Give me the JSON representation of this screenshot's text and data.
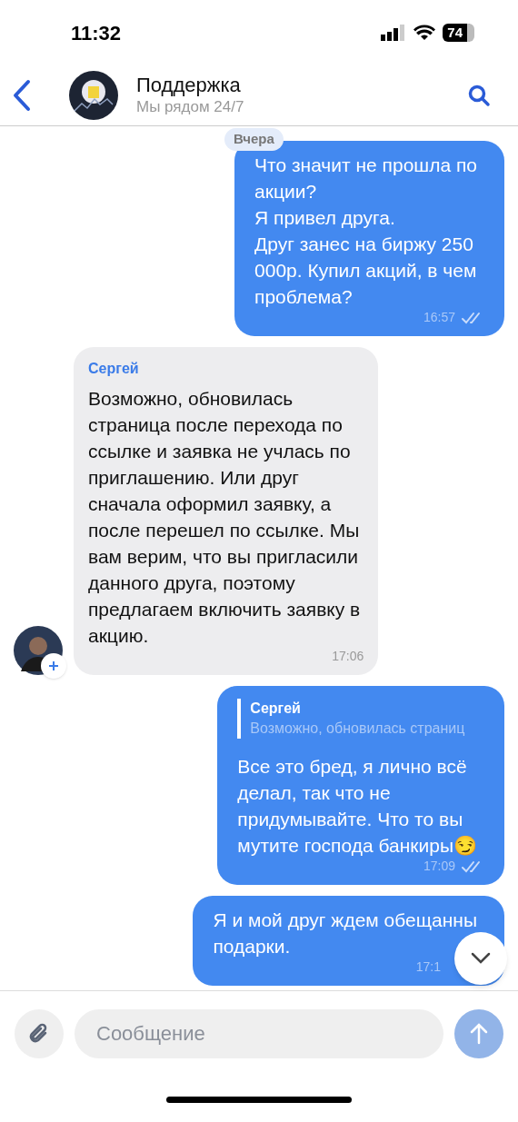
{
  "status_bar": {
    "time": "11:32",
    "battery": "74"
  },
  "header": {
    "title": "Поддержка",
    "subtitle": "Мы рядом 24/7"
  },
  "date_label": "Вчера",
  "messages": [
    {
      "kind": "outgoing",
      "text": "Что значит не прошла по\nакции?\nЯ привел друга.\nДруг занес на биржу 250\n000р. Купил акций, в чем\nпроблема?",
      "time": "16:57",
      "read": true
    },
    {
      "kind": "incoming",
      "sender": "Сергей",
      "text": "Возможно, обновилась\nстраница после перехода по\nссылке и заявка не учлась по\nприглашению. Или друг\nсначала оформил заявку, а\nпосле перешел по ссылке.  Мы\nвам верим, что вы пригласили\nданного друга, поэтому\nпредлагаем включить заявку в\nакцию.",
      "time": "17:06"
    },
    {
      "kind": "outgoing",
      "reply": {
        "sender": "Сергей",
        "text": "Возможно, обновилась страниц"
      },
      "text": "Все это бред, я лично всё\nделал, так что не\nпридумывайте. Что то вы\nмутите господа банкиры😏",
      "time": "17:09",
      "read": true
    },
    {
      "kind": "outgoing",
      "text": "Я и мой друг ждем обещанны\nподарки.",
      "time": "17:1"
    }
  ],
  "composer": {
    "placeholder": "Сообщение"
  }
}
